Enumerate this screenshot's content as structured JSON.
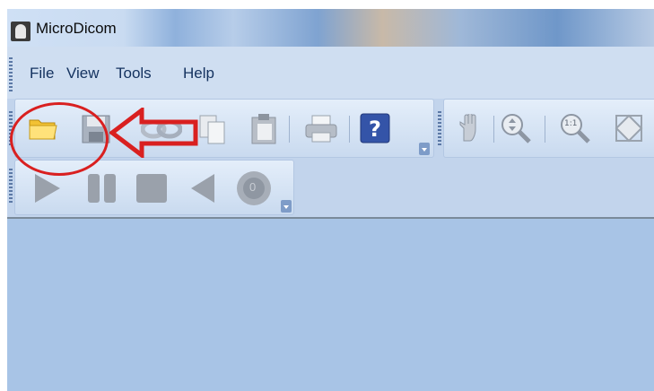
{
  "window": {
    "title": "MicroDicom"
  },
  "menu": {
    "items": [
      "File",
      "View",
      "Tools",
      "Help"
    ]
  },
  "toolbar_main": {
    "buttons": [
      "open-folder-icon",
      "save-icon",
      "link-icon",
      "copy-icon",
      "paste-icon",
      "print-icon",
      "help-icon"
    ]
  },
  "toolbar_image": {
    "buttons": [
      "pan-hand-icon",
      "zoom-icon",
      "actual-size-icon",
      "fit-icon"
    ],
    "actual_size_label": "1:1"
  },
  "toolbar_playback": {
    "buttons": [
      "play-icon",
      "pause-icon",
      "stop-icon",
      "previous-icon",
      "record-icon"
    ],
    "record_label": "0"
  },
  "annotation": {
    "color": "#d92020"
  }
}
